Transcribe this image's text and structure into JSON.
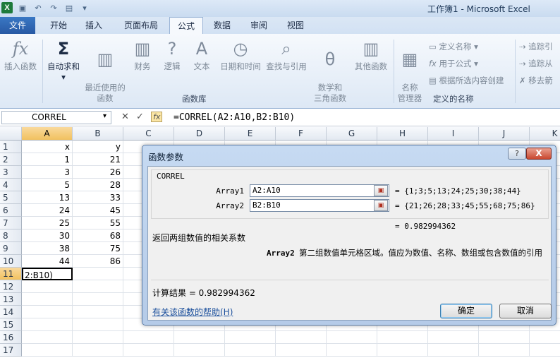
{
  "window": {
    "title": "工作簿1 - Microsoft Excel",
    "app_icon": "X"
  },
  "tabs": [
    "文件",
    "开始",
    "插入",
    "页面布局",
    "公式",
    "数据",
    "审阅",
    "视图"
  ],
  "ribbon": {
    "function_library": {
      "label": "函数库",
      "buttons": [
        "插入函数",
        "自动求和",
        "最近使用的\n函数",
        "财务",
        "逻辑",
        "文本",
        "日期和时间",
        "查找与引用",
        "数学和\n三角函数",
        "其他函数"
      ]
    },
    "defined_names": {
      "label": "定义的名称",
      "name_manager": "名称\n管理器",
      "define_name": "定义名称",
      "use_in_formula": "用于公式",
      "create_from_selection": "根据所选内容创建"
    },
    "audit": {
      "trace_precedents": "追踪引",
      "trace_dependents": "追踪从",
      "remove_arrows": "移去箭"
    }
  },
  "formula_bar": {
    "name_box": "CORREL",
    "formula": "=CORREL(A2:A10,B2:B10)"
  },
  "sheet": {
    "columns": [
      "A",
      "B",
      "C",
      "D",
      "E",
      "F",
      "G",
      "H",
      "I",
      "J",
      "K"
    ],
    "rows": [
      "1",
      "2",
      "3",
      "4",
      "5",
      "6",
      "7",
      "8",
      "9",
      "10",
      "11",
      "12",
      "13",
      "14",
      "15",
      "16",
      "17"
    ],
    "col_a": [
      "x",
      "1",
      "3",
      "5",
      "13",
      "24",
      "25",
      "30",
      "38",
      "44"
    ],
    "col_b": [
      "y",
      "21",
      "26",
      "28",
      "33",
      "45",
      "55",
      "68",
      "75",
      "86"
    ],
    "active_cell_text": "2:B10)"
  },
  "dialog": {
    "title": "函数参数",
    "help_button": "?",
    "close_button": "X",
    "function_name": "CORREL",
    "arg1_label": "Array1",
    "arg1_value": "A2:A10",
    "arg1_result": "= {1;3;5;13;24;25;30;38;44}",
    "arg2_label": "Array2",
    "arg2_value": "B2:B10",
    "arg2_result": "= {21;26;28;33;45;55;68;75;86}",
    "result_preview": "= 0.982994362",
    "description": "返回两组数值的相关系数",
    "arg_help_name": "Array2",
    "arg_help_text": "第二组数值单元格区域。值应为数值、名称、数组或包含数值的引用",
    "calc_result": "计算结果 = 0.982994362",
    "help_link": "有关该函数的帮助(H)",
    "ok": "确定",
    "cancel": "取消"
  }
}
